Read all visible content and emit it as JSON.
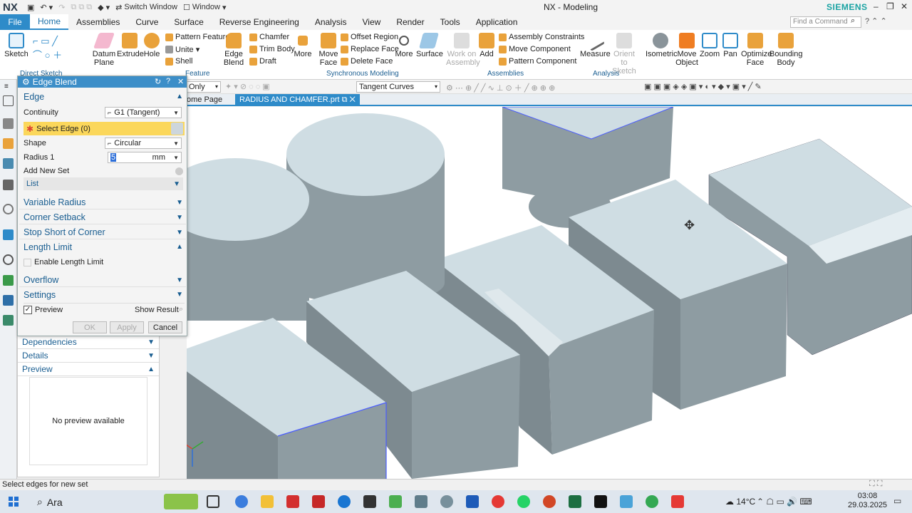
{
  "titlebar": {
    "logo": "NX",
    "switch_window": "Switch Window",
    "window_menu": "Window",
    "title": "NX - Modeling",
    "brand": "SIEMENS"
  },
  "menu": {
    "file": "File",
    "tabs": [
      "Home",
      "Assemblies",
      "Curve",
      "Surface",
      "Reverse Engineering",
      "Analysis",
      "View",
      "Render",
      "Tools",
      "Application"
    ],
    "find_placeholder": "Find a Command"
  },
  "ribbon": {
    "sketch": "Sketch",
    "datum_plane": "Datum Plane",
    "extrude": "Extrude",
    "hole": "Hole",
    "pattern_feature": "Pattern Feature",
    "unite": "Unite",
    "shell": "Shell",
    "edge_blend": "Edge Blend",
    "chamfer": "Chamfer",
    "trim_body": "Trim Body",
    "draft": "Draft",
    "more": "More",
    "move_face": "Move Face",
    "offset_region": "Offset Region",
    "replace_face": "Replace Face",
    "delete_face": "Delete Face",
    "more2": "More",
    "surface": "Surface",
    "work_on_assembly": "Work on Assembly",
    "add": "Add",
    "assembly_constraints": "Assembly Constraints",
    "move_component": "Move Component",
    "pattern_component": "Pattern Component",
    "measure": "Measure",
    "orient_to_sketch": "Orient to Sketch",
    "isometric": "Isometric",
    "move_object": "Move Object",
    "zoom": "Zoom",
    "pan": "Pan",
    "optimize_face": "Optimize Face",
    "bounding_body": "Bounding Body",
    "groups": {
      "direct_sketch": "Direct Sketch",
      "feature": "Feature",
      "synchronous_modeling": "Synchronous Modeling",
      "assemblies": "Assemblies",
      "analysis": "Analysis"
    }
  },
  "toolbar2": {
    "filter": "Only",
    "curve_rule": "Tangent Curves"
  },
  "doctabs": {
    "home": "ome Page",
    "active": "RADIUS AND CHAMFER.prt"
  },
  "dialog": {
    "title": "Edge Blend",
    "edge_section": "Edge",
    "continuity_label": "Continuity",
    "continuity_value": "G1 (Tangent)",
    "select_edge": "Select Edge (0)",
    "shape_label": "Shape",
    "shape_value": "Circular",
    "radius_label": "Radius 1",
    "radius_value": "5",
    "radius_unit": "mm",
    "add_new_set": "Add New Set",
    "list": "List",
    "sections": [
      "Variable Radius",
      "Corner Setback",
      "Stop Short of Corner",
      "Length Limit"
    ],
    "enable_length_limit": "Enable Length Limit",
    "overflow": "Overflow",
    "settings": "Settings",
    "preview": "Preview",
    "show_result": "Show Result",
    "ok": "OK",
    "apply": "Apply",
    "cancel": "Cancel"
  },
  "navpanel": {
    "dependencies": "Dependencies",
    "details": "Details",
    "preview": "Preview",
    "no_preview": "No preview available"
  },
  "status": "Select edges for new set",
  "taskbar": {
    "search": "Ara",
    "temperature": "14°C",
    "time": "03:08",
    "date": "29.03.2025"
  },
  "colors": {
    "accent": "#2e8bc9",
    "select_highlight": "#fbd75b",
    "model_top": "#cfdde3",
    "model_side": "#8e9ca2"
  }
}
